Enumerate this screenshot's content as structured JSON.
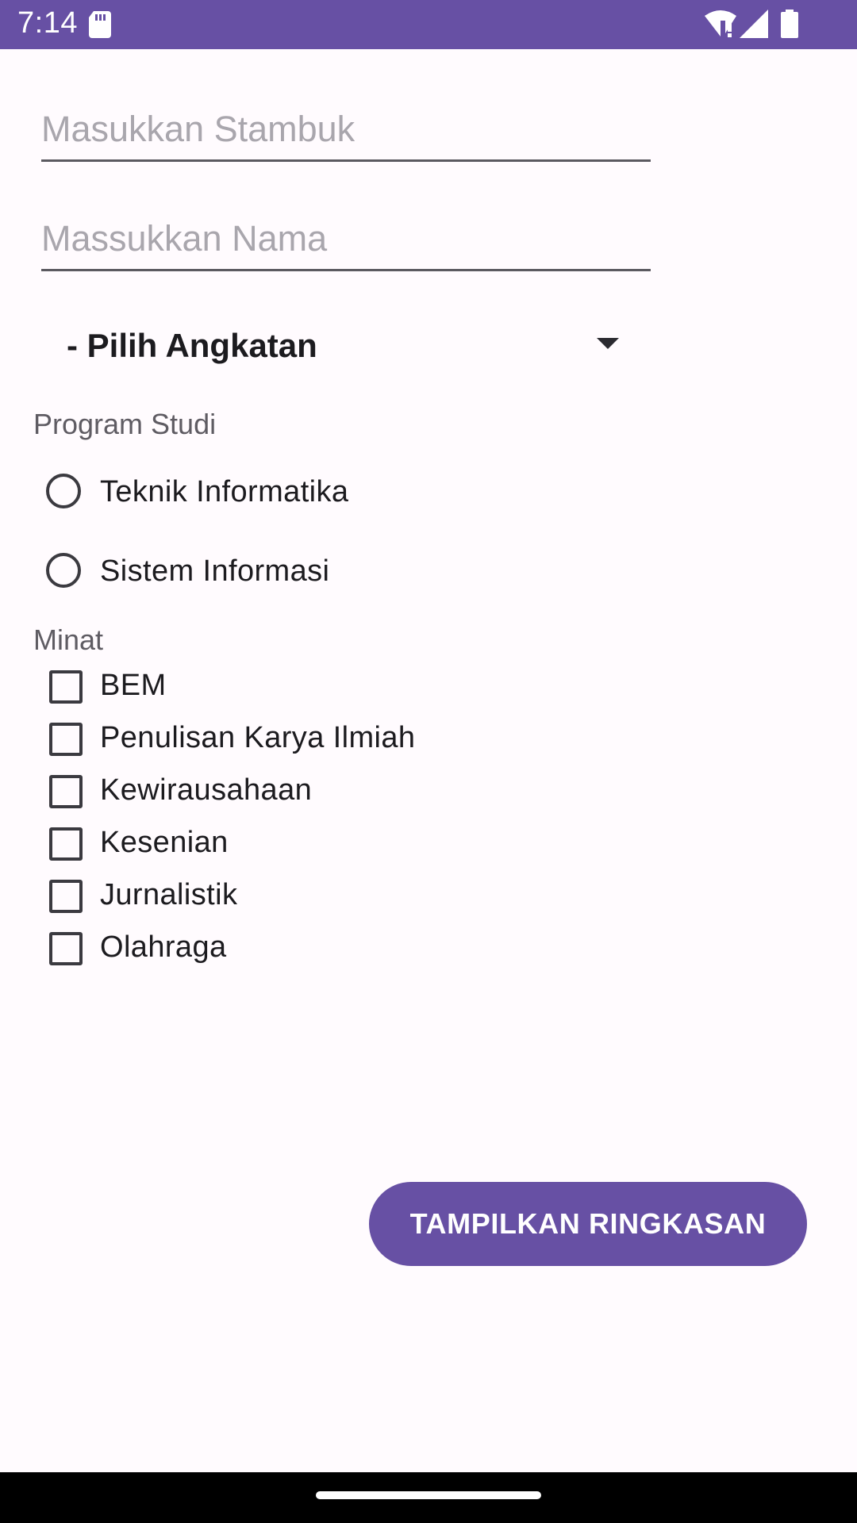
{
  "status_bar": {
    "time": "7:14",
    "icons": [
      "sd-card-icon",
      "wifi-alert-icon",
      "signal-icon",
      "battery-icon"
    ],
    "color": "#6750a4"
  },
  "form": {
    "stambuk_placeholder": "Masukkan Stambuk",
    "stambuk_value": "",
    "nama_placeholder": "Massukkan Nama",
    "nama_value": "",
    "angkatan_selected": "- Pilih Angkatan",
    "program_studi_label": "Program Studi",
    "program_studi_options": [
      {
        "label": "Teknik Informatika",
        "checked": false
      },
      {
        "label": "Sistem Informasi",
        "checked": false
      }
    ],
    "minat_label": "Minat",
    "minat_options": [
      {
        "label": "BEM",
        "checked": false
      },
      {
        "label": "Penulisan Karya Ilmiah",
        "checked": false
      },
      {
        "label": "Kewirausahaan",
        "checked": false
      },
      {
        "label": "Kesenian",
        "checked": false
      },
      {
        "label": "Jurnalistik",
        "checked": false
      },
      {
        "label": "Olahraga",
        "checked": false
      }
    ],
    "submit_label": "TAMPILKAN RINGKASAN"
  },
  "theme": {
    "accent": "#6750a4",
    "background": "#fffbfe"
  }
}
